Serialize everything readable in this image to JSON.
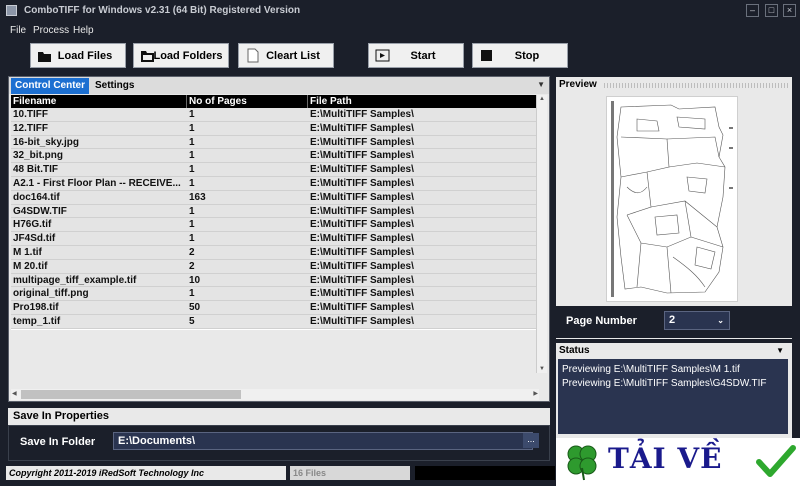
{
  "window": {
    "title": "ComboTIFF for Windows v2.31 (64 Bit)  Registered Version",
    "minimize_glyph": "–",
    "maximize_glyph": "□",
    "close_glyph": "×"
  },
  "menu": [
    {
      "label": "File"
    },
    {
      "label": "Process"
    },
    {
      "label": "Help"
    }
  ],
  "toolbar": {
    "load_files": "Load Files",
    "load_folders": "Load Folders",
    "clear_list": "Cleart List",
    "start": "Start",
    "stop": "Stop"
  },
  "tabs": {
    "control_center": "Control Center",
    "settings": "Settings",
    "menu_glyph": "▼"
  },
  "grid": {
    "columns": [
      "Filename",
      "No of Pages",
      "File Path"
    ],
    "rows": [
      {
        "name": "10.TIFF",
        "pages": "1",
        "path": "E:\\MultiTIFF Samples\\"
      },
      {
        "name": "12.TIFF",
        "pages": "1",
        "path": "E:\\MultiTIFF Samples\\"
      },
      {
        "name": "16-bit_sky.jpg",
        "pages": "1",
        "path": "E:\\MultiTIFF Samples\\"
      },
      {
        "name": "32_bit.png",
        "pages": "1",
        "path": "E:\\MultiTIFF Samples\\"
      },
      {
        "name": "48 Bit.TIF",
        "pages": "1",
        "path": "E:\\MultiTIFF Samples\\"
      },
      {
        "name": "A2.1 - First Floor Plan -- RECEIVE...",
        "pages": "1",
        "path": "E:\\MultiTIFF Samples\\"
      },
      {
        "name": "doc164.tif",
        "pages": "163",
        "path": "E:\\MultiTIFF Samples\\"
      },
      {
        "name": "G4SDW.TIF",
        "pages": "1",
        "path": "E:\\MultiTIFF Samples\\"
      },
      {
        "name": "H76G.tif",
        "pages": "1",
        "path": "E:\\MultiTIFF Samples\\"
      },
      {
        "name": "JF4Sd.tif",
        "pages": "1",
        "path": "E:\\MultiTIFF Samples\\"
      },
      {
        "name": "M 1.tif",
        "pages": "2",
        "path": "E:\\MultiTIFF Samples\\"
      },
      {
        "name": "M 20.tif",
        "pages": "2",
        "path": "E:\\MultiTIFF Samples\\"
      },
      {
        "name": "multipage_tiff_example.tif",
        "pages": "10",
        "path": "E:\\MultiTIFF Samples\\"
      },
      {
        "name": "original_tiff.png",
        "pages": "1",
        "path": "E:\\MultiTIFF Samples\\"
      },
      {
        "name": "Pro198.tif",
        "pages": "50",
        "path": "E:\\MultiTIFF Samples\\"
      },
      {
        "name": "temp_1.tif",
        "pages": "5",
        "path": "E:\\MultiTIFF Samples\\"
      }
    ]
  },
  "save": {
    "header": "Save In Properties",
    "label": "Save In Folder",
    "value": "E:\\Documents\\",
    "browse_glyph": "..."
  },
  "preview": {
    "header": "Preview",
    "page_number_label": "Page Number",
    "page_number_value": "2"
  },
  "status": {
    "header": "Status",
    "lines": [
      "Previewing E:\\MultiTIFF Samples\\M 1.tif",
      "Previewing E:\\MultiTIFF Samples\\G4SDW.TIF"
    ]
  },
  "statusbar": {
    "copyright": "Copyright 2011-2019 iRedSoft Technology Inc",
    "files": "16 Files"
  },
  "watermark": {
    "text": "TẢI VỀ"
  },
  "colors": {
    "background": "#1b1f2a",
    "active_tab": "#1c6fd1",
    "input_bg": "#2a3450"
  }
}
